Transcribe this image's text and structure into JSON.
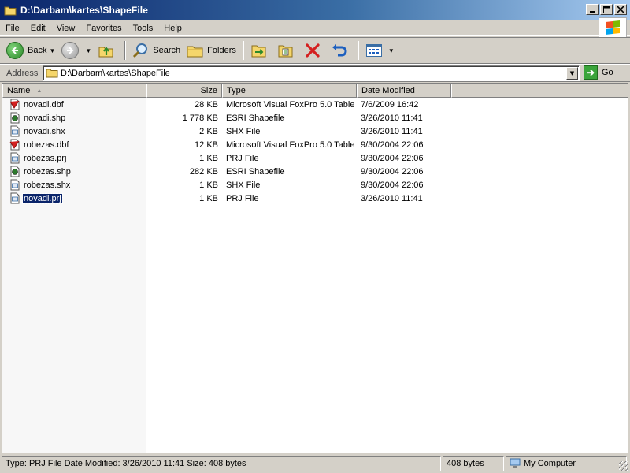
{
  "window": {
    "title": "D:\\Darbam\\kartes\\ShapeFile",
    "controls": [
      "_",
      "□",
      "✕"
    ]
  },
  "menu": [
    "File",
    "Edit",
    "View",
    "Favorites",
    "Tools",
    "Help"
  ],
  "toolbar": {
    "back_label": "Back",
    "search_label": "Search",
    "folders_label": "Folders"
  },
  "address": {
    "label": "Address",
    "value": "D:\\Darbam\\kartes\\ShapeFile",
    "go_label": "Go"
  },
  "columns": {
    "name": "Name",
    "size": "Size",
    "type": "Type",
    "date": "Date Modified"
  },
  "files": [
    {
      "name": "novadi.dbf",
      "size": "28 KB",
      "type": "Microsoft Visual FoxPro 5.0 Table",
      "date": "7/6/2009 16:42",
      "icon": "dbf-icon"
    },
    {
      "name": "novadi.shp",
      "size": "1 778 KB",
      "type": "ESRI Shapefile",
      "date": "3/26/2010 11:41",
      "icon": "shp-icon"
    },
    {
      "name": "novadi.shx",
      "size": "2 KB",
      "type": "SHX File",
      "date": "3/26/2010 11:41",
      "icon": "generic-file-icon"
    },
    {
      "name": "robezas.dbf",
      "size": "12 KB",
      "type": "Microsoft Visual FoxPro 5.0 Table",
      "date": "9/30/2004 22:06",
      "icon": "dbf-icon"
    },
    {
      "name": "robezas.prj",
      "size": "1 KB",
      "type": "PRJ File",
      "date": "9/30/2004 22:06",
      "icon": "generic-file-icon"
    },
    {
      "name": "robezas.shp",
      "size": "282 KB",
      "type": "ESRI Shapefile",
      "date": "9/30/2004 22:06",
      "icon": "shp-icon"
    },
    {
      "name": "robezas.shx",
      "size": "1 KB",
      "type": "SHX File",
      "date": "9/30/2004 22:06",
      "icon": "generic-file-icon"
    },
    {
      "name": "novadi.prj",
      "size": "1 KB",
      "type": "PRJ File",
      "date": "3/26/2010 11:41",
      "icon": "generic-file-icon",
      "selected": true
    }
  ],
  "status": {
    "details": "Type: PRJ File Date Modified: 3/26/2010 11:41 Size: 408 bytes",
    "size": "408 bytes",
    "location": "My Computer"
  },
  "colors": {
    "title_bar_start": "#0a246a",
    "title_bar_end": "#a6caf0",
    "selection": "#0a246a",
    "chrome": "#d4d0c8"
  }
}
